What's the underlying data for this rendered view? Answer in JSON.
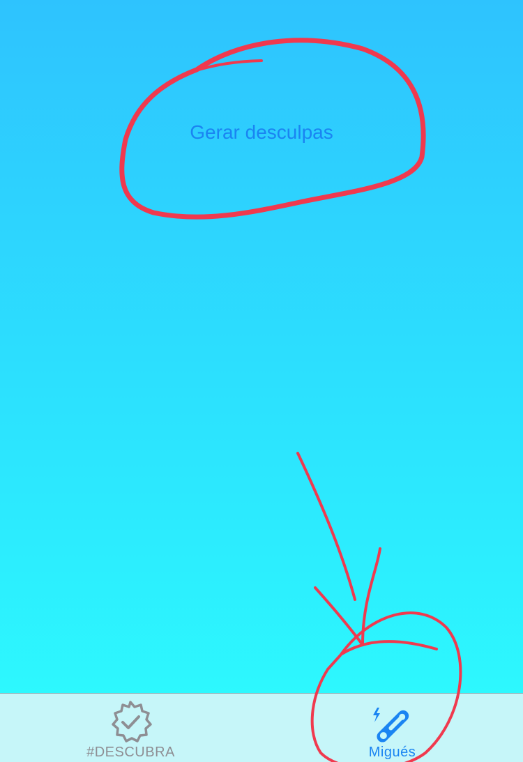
{
  "main": {
    "generate_button_label": "Gerar desculpas"
  },
  "tab_bar": {
    "tabs": [
      {
        "label": "#DESCUBRA",
        "icon": "verified-badge-icon",
        "selected": false
      },
      {
        "label": "Migués",
        "icon": "safety-pin-icon",
        "selected": true
      }
    ]
  },
  "colors": {
    "background_top": "#2ec3fe",
    "background_bottom": "#2dfdfe",
    "accent": "#1a84f2",
    "inactive": "#8e8e93",
    "annotation": "#f0394e"
  }
}
